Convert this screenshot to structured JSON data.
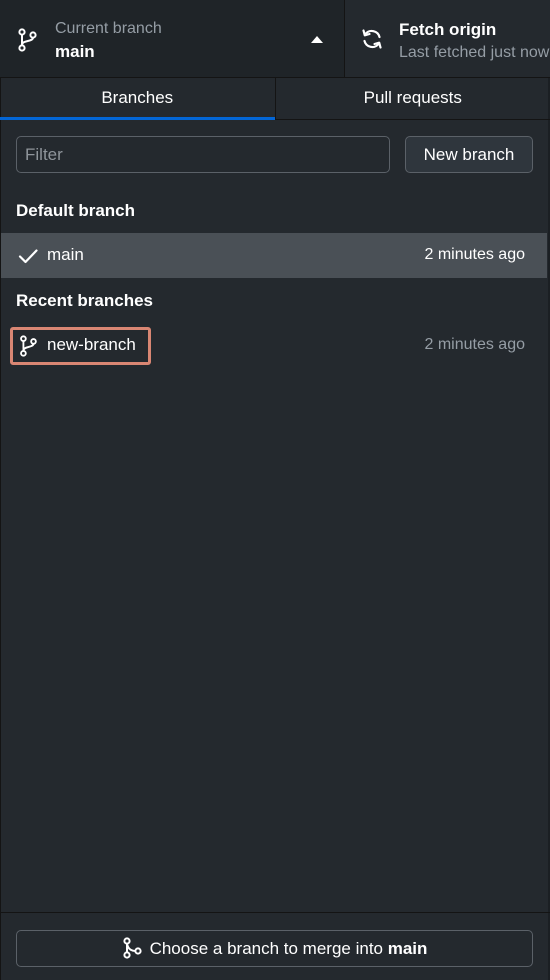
{
  "toolbar": {
    "current_branch": {
      "label": "Current branch",
      "value": "main",
      "icon": "git-branch-icon"
    },
    "fetch": {
      "title": "Fetch origin",
      "subtitle": "Last fetched just now",
      "icon": "sync-icon"
    }
  },
  "tabs": [
    {
      "label": "Branches",
      "selected": true
    },
    {
      "label": "Pull requests",
      "selected": false
    }
  ],
  "filter": {
    "placeholder": "Filter",
    "value": ""
  },
  "new_branch_label": "New branch",
  "sections": {
    "default": {
      "header": "Default branch",
      "branches": [
        {
          "name": "main",
          "time": "2 minutes ago",
          "icon": "check-icon",
          "selected": true
        }
      ]
    },
    "recent": {
      "header": "Recent branches",
      "branches": [
        {
          "name": "new-branch",
          "time": "2 minutes ago",
          "icon": "git-branch-icon",
          "selected": false
        }
      ]
    }
  },
  "merge_button": {
    "prefix": "Choose a branch to merge into ",
    "target": "main",
    "icon": "git-merge-icon"
  },
  "colors": {
    "background": "#24292e",
    "selected_row": "#4a5056",
    "accent": "#0366d6",
    "highlight": "#d98673"
  }
}
